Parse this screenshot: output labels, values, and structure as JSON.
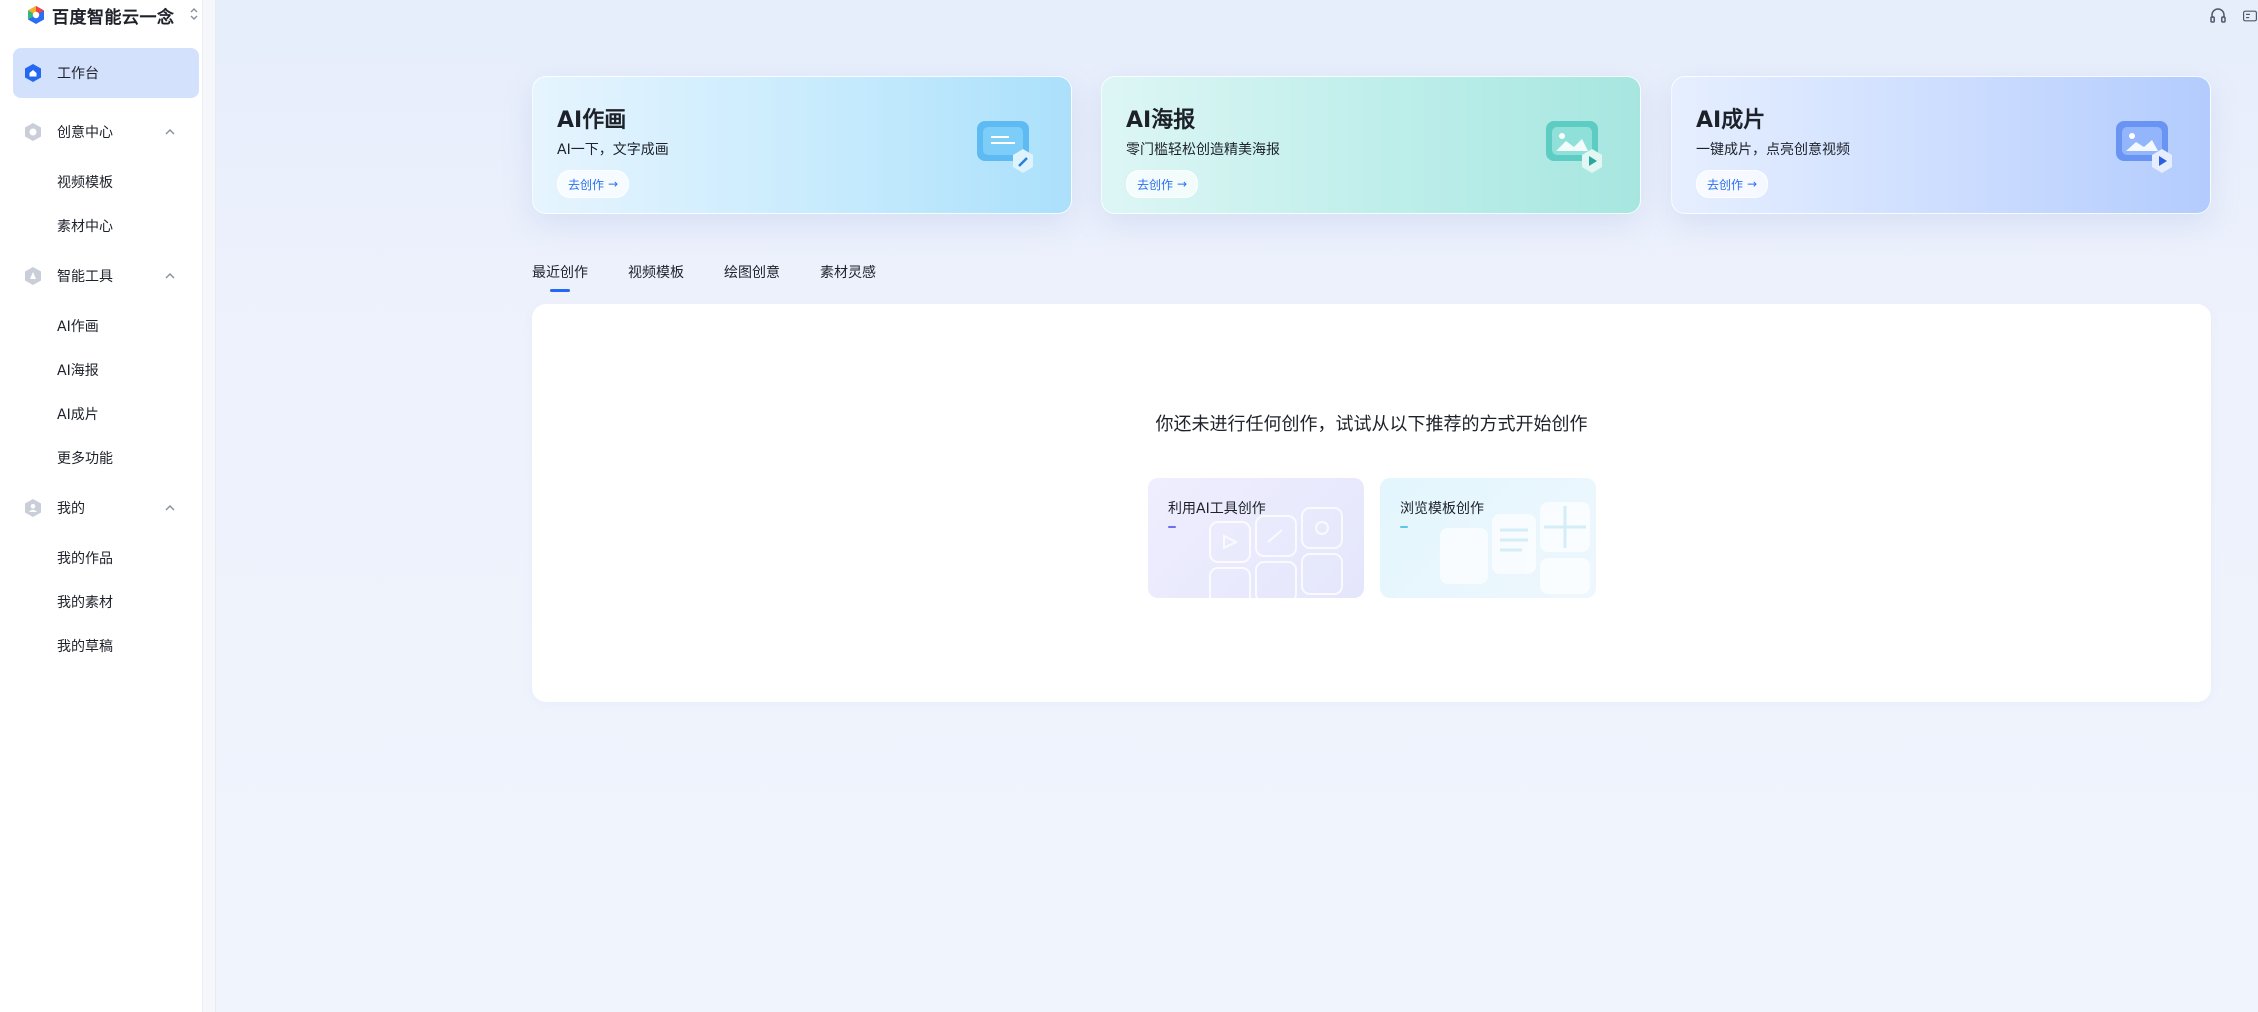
{
  "brand": {
    "name": "百度智能云一念",
    "switch_glyph": "⌃⌄"
  },
  "sidebar": {
    "workbench": "工作台",
    "groups": [
      {
        "label": "创意中心",
        "icon": "creative-center-icon",
        "items": [
          "视频模板",
          "素材中心"
        ]
      },
      {
        "label": "智能工具",
        "icon": "smart-tools-icon",
        "items": [
          "AI作画",
          "AI海报",
          "AI成片",
          "更多功能"
        ]
      },
      {
        "label": "我的",
        "icon": "user-icon",
        "items": [
          "我的作品",
          "我的素材",
          "我的草稿"
        ]
      }
    ]
  },
  "cards": [
    {
      "title": "AI作画",
      "desc": "AI一下，文字成画",
      "button": "去创作",
      "icon": "image-edit-icon"
    },
    {
      "title": "AI海报",
      "desc": "零门槛轻松创造精美海报",
      "button": "去创作",
      "icon": "poster-icon"
    },
    {
      "title": "AI成片",
      "desc": "一键成片，点亮创意视频",
      "button": "去创作",
      "icon": "video-icon"
    }
  ],
  "tabs": [
    "最近创作",
    "视频模板",
    "绘图创意",
    "素材灵感"
  ],
  "empty": {
    "message": "你还未进行任何创作，试试从以下推荐的方式开始创作",
    "suggestions": [
      "利用AI工具创作",
      "浏览模板创作"
    ]
  },
  "colors": {
    "accent": "#2468f2",
    "active_nav_bg": "#d4e1fc"
  }
}
